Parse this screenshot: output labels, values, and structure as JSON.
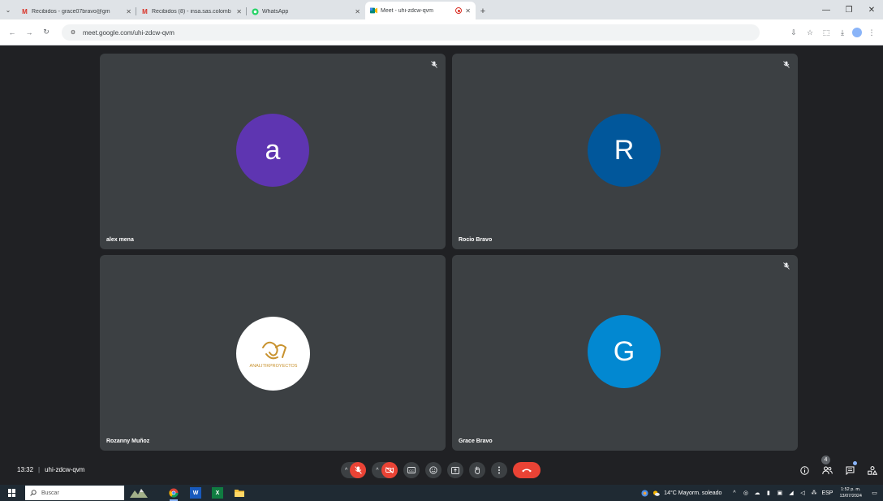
{
  "browser": {
    "tabs": [
      {
        "title": "Recibidos - grace07bravo@gm",
        "favicon": "gmail-icon",
        "active": false
      },
      {
        "title": "Recibidos (8) - insa.sas.colomb",
        "favicon": "gmail-icon",
        "active": false
      },
      {
        "title": "WhatsApp",
        "favicon": "whatsapp-icon",
        "active": false
      },
      {
        "title": "Meet - uhi-zdcw-qvm",
        "favicon": "meet-icon",
        "active": true
      }
    ],
    "url": "meet.google.com/uhi-zdcw-qvm"
  },
  "participants": [
    {
      "name": "alex mena",
      "initial": "a",
      "color": "#5e35b1",
      "muted": true
    },
    {
      "name": "Rocio Bravo",
      "initial": "R",
      "color": "#01579b",
      "muted": true
    },
    {
      "name": "Rozanny Muñoz",
      "initial": "",
      "logo_text": "ANALITIKPROYECTOS",
      "color": "#ffffff",
      "muted": false
    },
    {
      "name": "Grace Bravo",
      "initial": "G",
      "color": "#0288d1",
      "muted": true
    }
  ],
  "meeting": {
    "time": "13:32",
    "code": "uhi-zdcw-qvm",
    "participant_count": "4"
  },
  "taskbar": {
    "search_placeholder": "Buscar",
    "weather": "14°C  Mayorm. soleado",
    "language": "ESP",
    "clock_time": "1:52 p. m.",
    "clock_date": "13/07/2024"
  },
  "colors": {
    "meet_bg": "#202124",
    "tile_bg": "#3c4043",
    "alert_red": "#ea4335"
  }
}
